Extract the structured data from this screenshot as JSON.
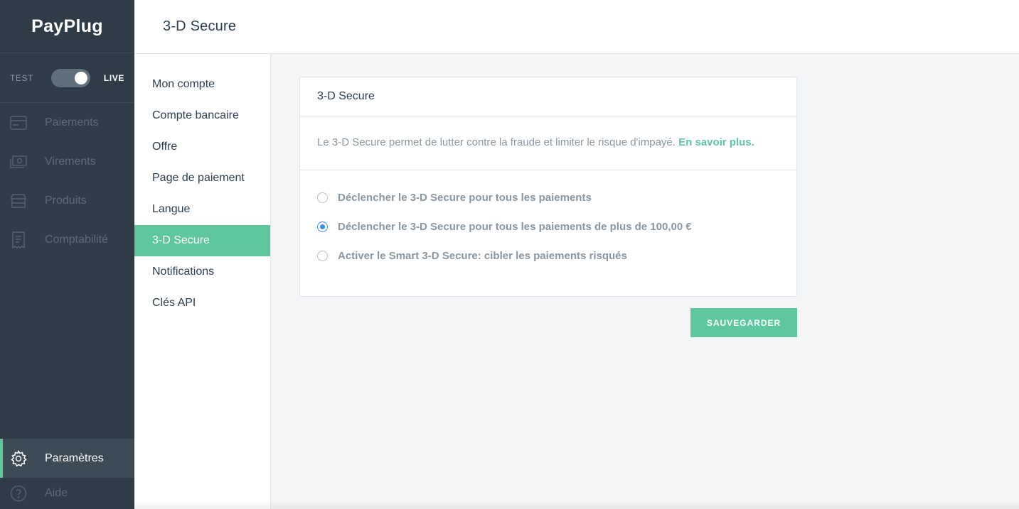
{
  "brand": {
    "name": "PayPlug",
    "accent": "#5ec79e",
    "sidebar_bg": "#2f3c47"
  },
  "mode": {
    "test_label": "TEST",
    "live_label": "LIVE",
    "live_enabled": true
  },
  "sidebar": {
    "items": [
      {
        "label": "Paiements",
        "icon": "card-icon"
      },
      {
        "label": "Virements",
        "icon": "cash-icon"
      },
      {
        "label": "Produits",
        "icon": "store-icon"
      },
      {
        "label": "Comptabilité",
        "icon": "receipt-icon"
      }
    ],
    "settings": {
      "label": "Paramètres",
      "icon": "gear-icon",
      "active": true
    },
    "help": {
      "label": "Aide",
      "icon": "help-icon"
    }
  },
  "header": {
    "title": "3-D Secure"
  },
  "submenu": {
    "items": [
      {
        "label": "Mon compte"
      },
      {
        "label": "Compte bancaire"
      },
      {
        "label": "Offre"
      },
      {
        "label": "Page de paiement"
      },
      {
        "label": "Langue"
      },
      {
        "label": "3-D Secure",
        "active": true
      },
      {
        "label": "Notifications"
      },
      {
        "label": "Clés API"
      }
    ]
  },
  "card": {
    "title": "3-D Secure",
    "description": "Le 3-D Secure permet de lutter contre la fraude et limiter le risque d'impayé.",
    "link_label": "En savoir plus.",
    "options": [
      {
        "label": "Déclencher le 3-D Secure pour tous les paiements",
        "checked": false
      },
      {
        "label": "Déclencher le 3-D Secure pour tous les paiements de plus de 100,00 €",
        "checked": true
      },
      {
        "label": "Activer le Smart 3-D Secure: cibler les paiements risqués",
        "checked": false
      }
    ]
  },
  "actions": {
    "save_label": "SAUVEGARDER"
  }
}
